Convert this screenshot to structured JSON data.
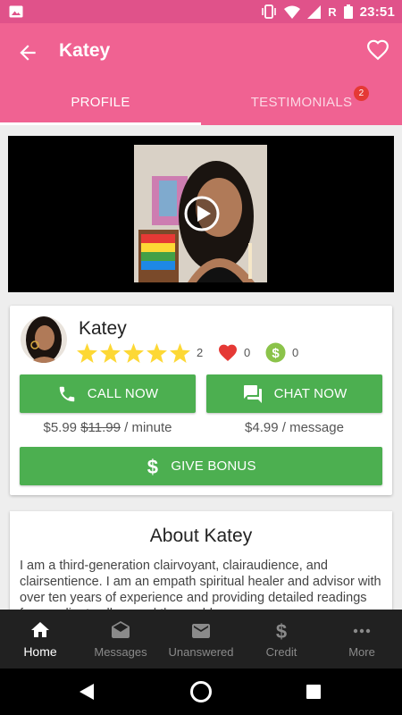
{
  "status_bar": {
    "time": "23:51",
    "network_letter": "R"
  },
  "header": {
    "title": "Katey"
  },
  "tabs": [
    {
      "label": "PROFILE",
      "active": true
    },
    {
      "label": "TESTIMONIALS",
      "active": false,
      "badge": "2"
    }
  ],
  "reader": {
    "name": "Katey",
    "rating_stars": 5,
    "rating_count": "2",
    "favorites_count": "0",
    "bonus_count": "0"
  },
  "actions": {
    "call_label": "CALL NOW",
    "chat_label": "CHAT NOW",
    "bonus_label": "GIVE BONUS",
    "call_price": "$5.99",
    "call_price_old": "$11.99",
    "call_price_unit": "/ minute",
    "chat_price": "$4.99 / message"
  },
  "about": {
    "title": "About Katey",
    "text": "I am a third-generation clairvoyant, clairaudience, and clairsentience. I am an empath spiritual healer and advisor with over ten years of experience and providing detailed readings for my clients all around the world."
  },
  "bottom_nav": [
    {
      "label": "Home",
      "icon": "home-icon",
      "active": true
    },
    {
      "label": "Messages",
      "icon": "messages-icon",
      "active": false
    },
    {
      "label": "Unanswered",
      "icon": "mail-icon",
      "active": false
    },
    {
      "label": "Credit",
      "icon": "dollar-icon",
      "active": false
    },
    {
      "label": "More",
      "icon": "more-icon",
      "active": false
    }
  ],
  "colors": {
    "app_bar": "#f06292",
    "status_bar": "#e0528a",
    "action_green": "#4caf50",
    "star": "#fdd835",
    "heart": "#e53935"
  }
}
